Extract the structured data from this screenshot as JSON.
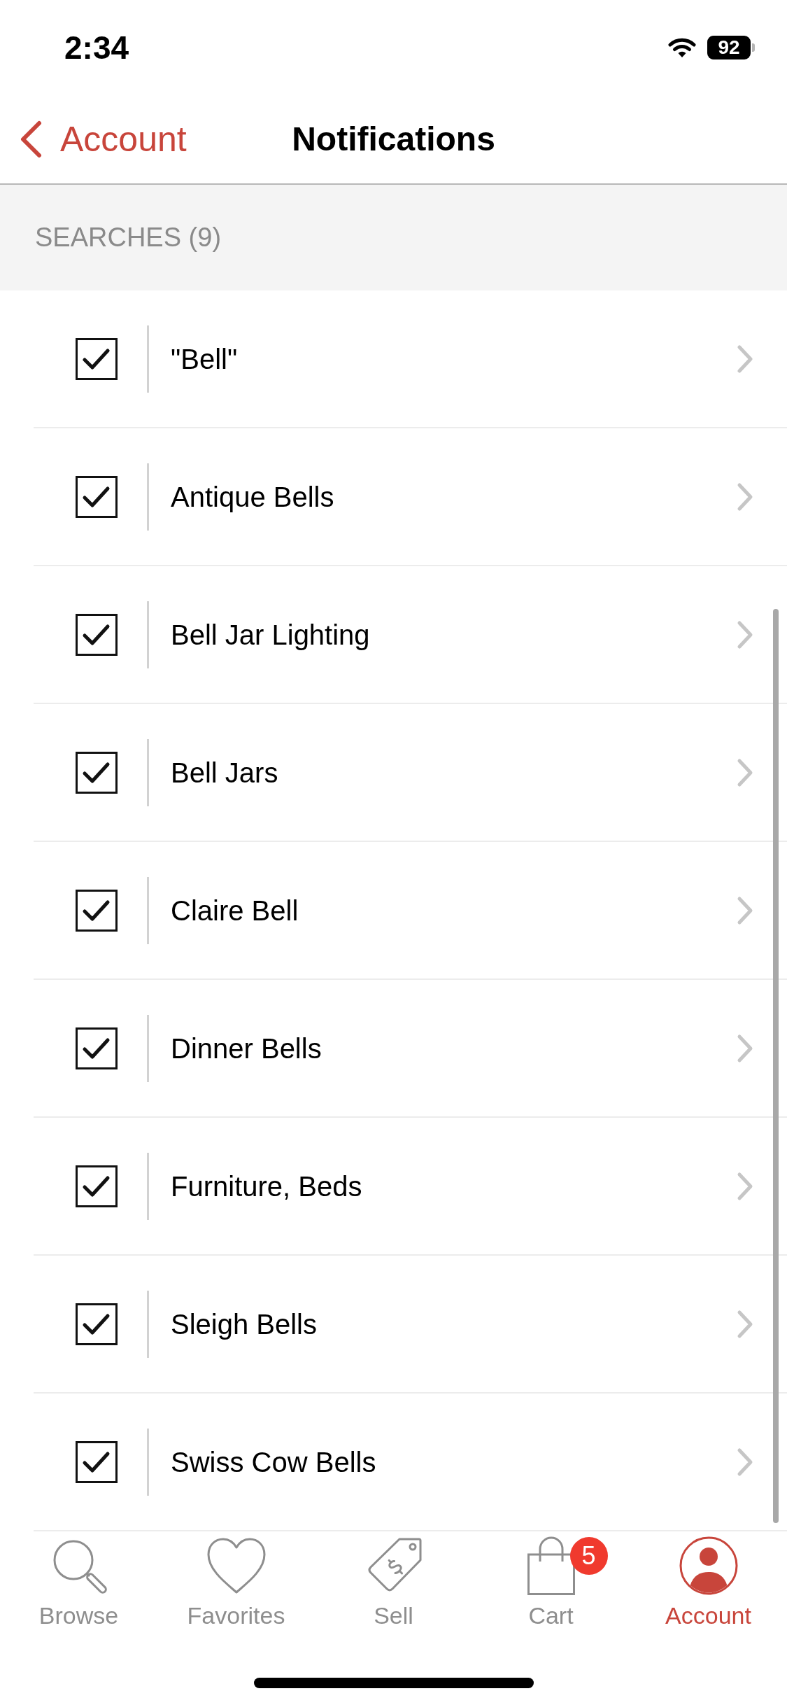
{
  "status_bar": {
    "time": "2:34",
    "battery": "92"
  },
  "nav_bar": {
    "back_label": "Account",
    "title": "Notifications"
  },
  "section": {
    "title": "SEARCHES (9)"
  },
  "searches": [
    {
      "label": "\"Bell\"",
      "checked": true
    },
    {
      "label": "Antique Bells",
      "checked": true
    },
    {
      "label": "Bell Jar Lighting",
      "checked": true
    },
    {
      "label": "Bell Jars",
      "checked": true
    },
    {
      "label": "Claire Bell",
      "checked": true
    },
    {
      "label": "Dinner Bells",
      "checked": true
    },
    {
      "label": "Furniture, Beds",
      "checked": true
    },
    {
      "label": "Sleigh Bells",
      "checked": true
    },
    {
      "label": "Swiss Cow Bells",
      "checked": true
    }
  ],
  "tab_bar": {
    "tabs": [
      {
        "label": "Browse",
        "selected": false
      },
      {
        "label": "Favorites",
        "selected": false
      },
      {
        "label": "Sell",
        "selected": false
      },
      {
        "label": "Cart",
        "selected": false,
        "badge": "5"
      },
      {
        "label": "Account",
        "selected": true
      }
    ]
  }
}
